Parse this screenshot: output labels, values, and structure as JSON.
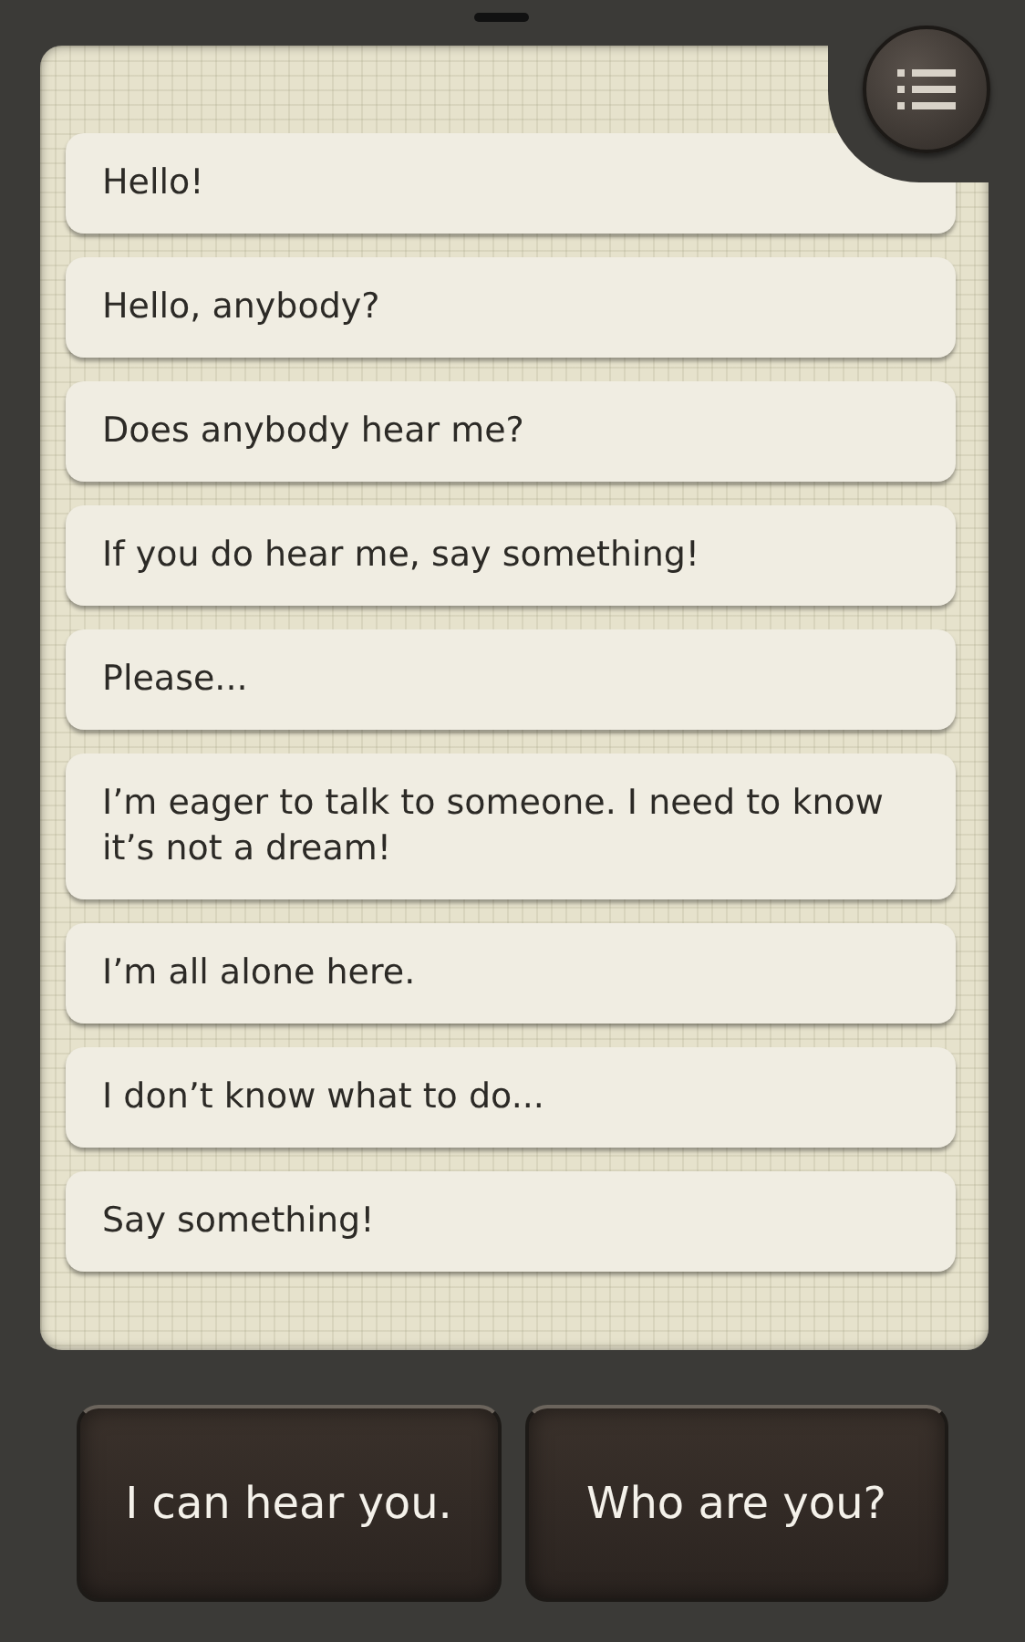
{
  "messages": [
    {
      "text": "Hello!"
    },
    {
      "text": "Hello, anybody?"
    },
    {
      "text": "Does anybody hear me?"
    },
    {
      "text": "If you do hear me, say something!"
    },
    {
      "text": "Please..."
    },
    {
      "text": "I’m eager to talk to someone. I need to know it’s not a dream!"
    },
    {
      "text": "I’m all alone here."
    },
    {
      "text": "I don’t know what to do..."
    },
    {
      "text": "Say something!"
    }
  ],
  "replies": [
    {
      "label": "I can hear you."
    },
    {
      "label": "Who are you?"
    }
  ]
}
